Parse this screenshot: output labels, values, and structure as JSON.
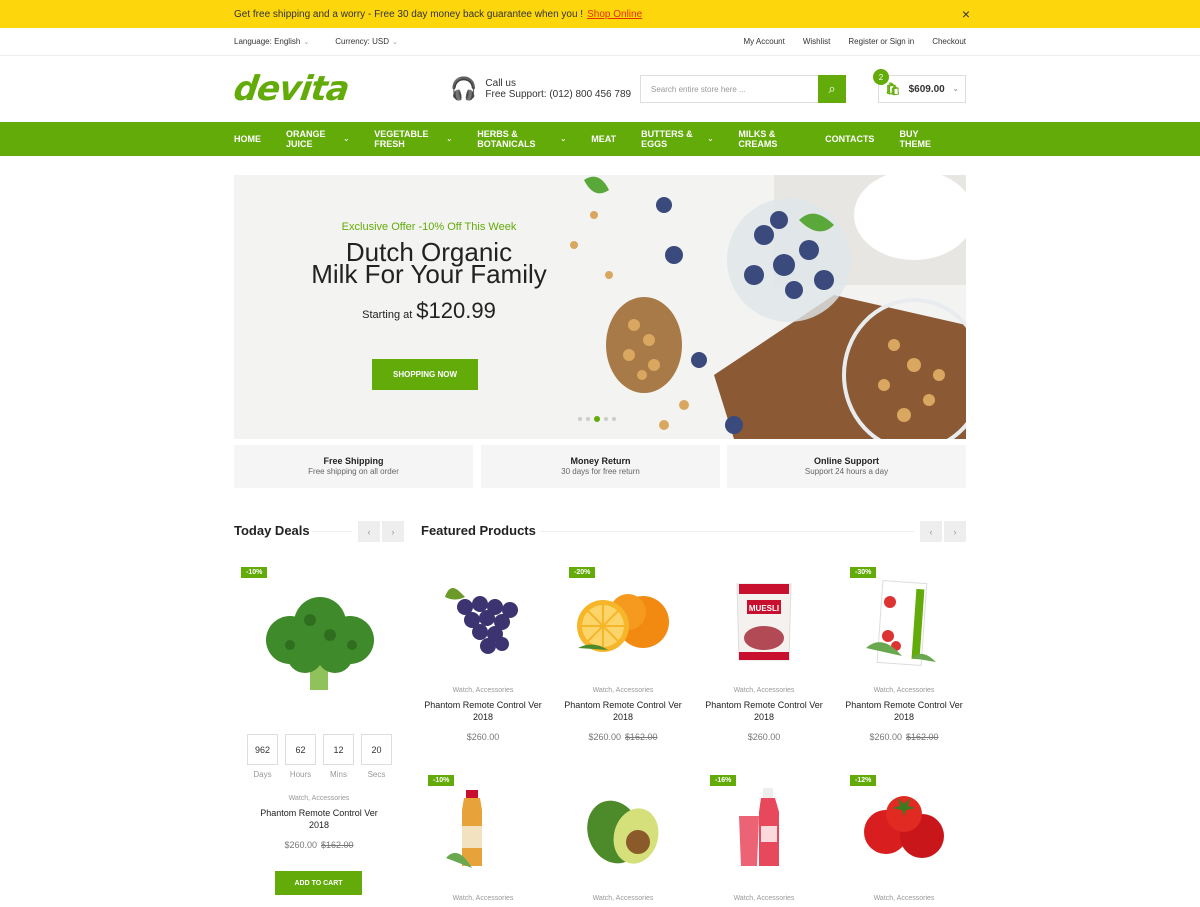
{
  "topbar": {
    "message": "Get free shipping and a worry - Free 30 day money back guarantee when you !",
    "link": "Shop Online",
    "close": "×"
  },
  "subbar": {
    "language_label": "Language:",
    "language": "English",
    "currency_label": "Currency:",
    "currency": "USD",
    "links": [
      "My Account",
      "Wishlist",
      "Register or Sign in",
      "Checkout"
    ]
  },
  "header": {
    "logo": "devita",
    "call_us": "Call us",
    "support": "Free Support: (012) 800 456 789",
    "search_placeholder": "Search entire store here ...",
    "cart_count": "2",
    "cart_total": "$609.00"
  },
  "nav": [
    "HOME",
    "ORANGE JUICE",
    "VEGETABLE FRESH",
    "HERBS & BOTANICALS",
    "MEAT",
    "BUTTERS & EGGS",
    "MILKS & CREAMS",
    "CONTACTS",
    "BUY THEME"
  ],
  "hero": {
    "offer": "Exclusive Offer -10% Off This Week",
    "title1": "Dutch Organic",
    "title2": "Milk For Your Family",
    "starting": "Starting at",
    "price": "$120.99",
    "button": "SHOPPING NOW"
  },
  "features": [
    {
      "title": "Free Shipping",
      "sub": "Free shipping on all order"
    },
    {
      "title": "Money Return",
      "sub": "30 days for free return"
    },
    {
      "title": "Online Support",
      "sub": "Support 24 hours a day"
    }
  ],
  "deals": {
    "title": "Today Deals",
    "badge": "-10%",
    "countdown": [
      {
        "value": "962",
        "label": "Days"
      },
      {
        "value": "62",
        "label": "Hours"
      },
      {
        "value": "12",
        "label": "Mins"
      },
      {
        "value": "20",
        "label": "Secs"
      }
    ],
    "cat": "Watch, Accessories",
    "name": "Phantom Remote Control Ver 2018",
    "price": "$260.00",
    "old": "$162.00",
    "button": "ADD TO CART"
  },
  "featured": {
    "title": "Featured Products",
    "products": [
      {
        "cat": "Watch, Accessories",
        "name": "Phantom Remote Control Ver 2018",
        "price": "$260.00",
        "old": ""
      },
      {
        "cat": "Watch, Accessories",
        "name": "Phantom Remote Control Ver 2018",
        "price": "$260.00",
        "old": "$162.00",
        "badge": "-20%"
      },
      {
        "cat": "Watch, Accessories",
        "name": "Phantom Remote Control Ver 2018",
        "price": "$260.00",
        "old": ""
      },
      {
        "cat": "Watch, Accessories",
        "name": "Phantom Remote Control Ver 2018",
        "price": "$260.00",
        "old": "$162.00",
        "badge": "-30%"
      }
    ],
    "row2_badges": [
      "-10%",
      "-16%",
      "-12%"
    ],
    "row2_cat": "Watch, Accessories"
  },
  "colors": {
    "accent": "#62ab09",
    "topbar": "#fdd60c"
  }
}
